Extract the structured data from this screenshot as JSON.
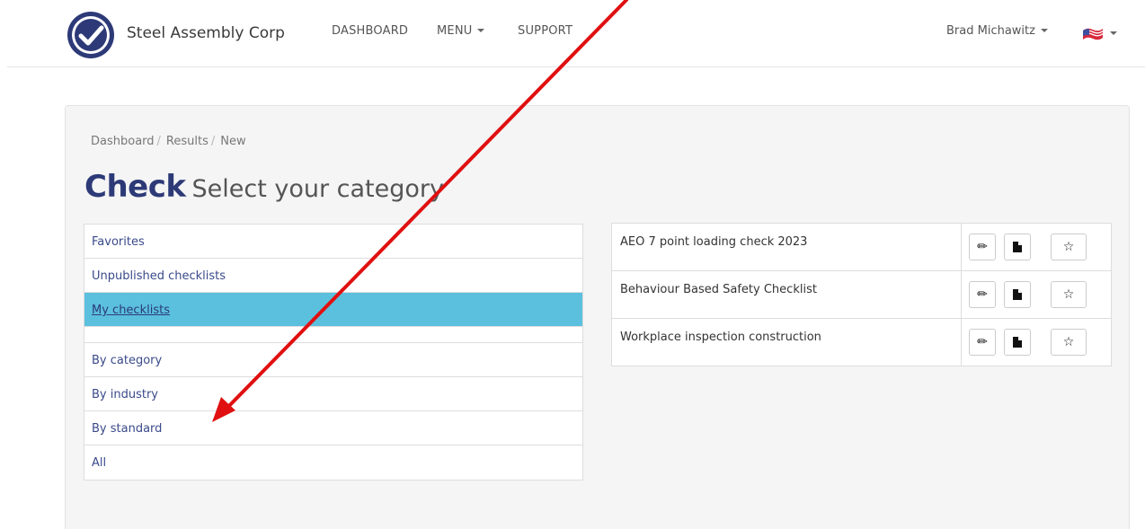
{
  "navbar": {
    "brand": "Steel Assembly Corp",
    "links": [
      {
        "label": "DASHBOARD"
      },
      {
        "label": "MENU"
      },
      {
        "label": "SUPPORT"
      }
    ],
    "user": "Brad Michawitz",
    "logo_icon": "check-badge-icon",
    "flag_icon": "us-flag-icon"
  },
  "breadcrumb": [
    "Dashboard",
    "Results",
    "New"
  ],
  "heading": {
    "main": "Check",
    "sub": "Select your category"
  },
  "categories": [
    {
      "label": "Favorites"
    },
    {
      "label": "Unpublished checklists"
    },
    {
      "label": "My checklists",
      "active": true
    },
    {
      "label": ""
    },
    {
      "label": "By category"
    },
    {
      "label": "By industry"
    },
    {
      "label": "By standard"
    },
    {
      "label": "All"
    }
  ],
  "checklists": [
    {
      "name": "AEO 7 point loading check 2023"
    },
    {
      "name": "Behaviour Based Safety Checklist"
    },
    {
      "name": "Workplace inspection construction"
    }
  ],
  "row_actions": {
    "edit_icon": "pencil-icon",
    "doc_icon": "document-icon",
    "star_icon": "star-icon"
  },
  "colors": {
    "accent": "#2d3a77",
    "active_bg": "#5bc0de",
    "annotation_arrow": "#e01010"
  }
}
